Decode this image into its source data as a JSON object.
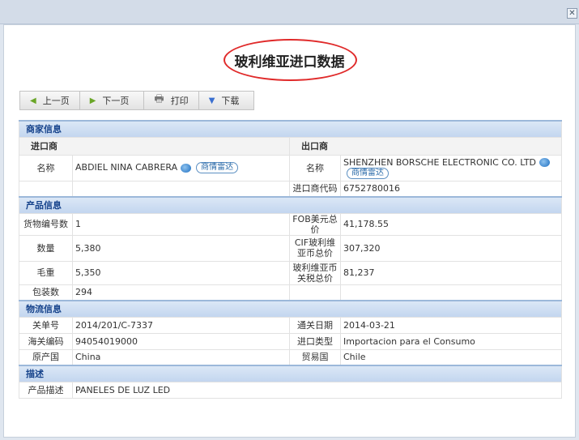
{
  "title": "玻利维亚进口数据",
  "toolbar": {
    "prev": "上一页",
    "next": "下一页",
    "print": "打印",
    "download": "下载"
  },
  "merchant": {
    "section": "商家信息",
    "importer_header": "进口商",
    "exporter_header": "出口商",
    "name_label": "名称",
    "importer_name": "ABDIEL NINA CABRERA",
    "exporter_name": "SHENZHEN BORSCHE ELECTRONIC CO. LTD",
    "radar": "商情雷达",
    "code_label": "进口商代码",
    "code": "6752780016"
  },
  "product": {
    "section": "产品信息",
    "rows": [
      {
        "l1": "货物编号数",
        "v1": "1",
        "l2": "FOB美元总价",
        "v2": "41,178.55"
      },
      {
        "l1": "数量",
        "v1": "5,380",
        "l2": "CIF玻利维亚币总价",
        "v2": "307,320"
      },
      {
        "l1": "毛重",
        "v1": "5,350",
        "l2": "玻利维亚币关税总价",
        "v2": "81,237"
      },
      {
        "l1": "包装数",
        "v1": "294",
        "l2": "",
        "v2": ""
      }
    ]
  },
  "logistics": {
    "section": "物流信息",
    "rows": [
      {
        "l1": "关单号",
        "v1": "2014/201/C-7337",
        "l2": "通关日期",
        "v2": "2014-03-21"
      },
      {
        "l1": "海关编码",
        "v1": "94054019000",
        "l2": "进口类型",
        "v2": "Importacion para el Consumo"
      },
      {
        "l1": "原产国",
        "v1": "China",
        "l2": "贸易国",
        "v2": "Chile"
      }
    ]
  },
  "description": {
    "section": "描述",
    "label": "产品描述",
    "value": "PANELES DE LUZ LED"
  }
}
